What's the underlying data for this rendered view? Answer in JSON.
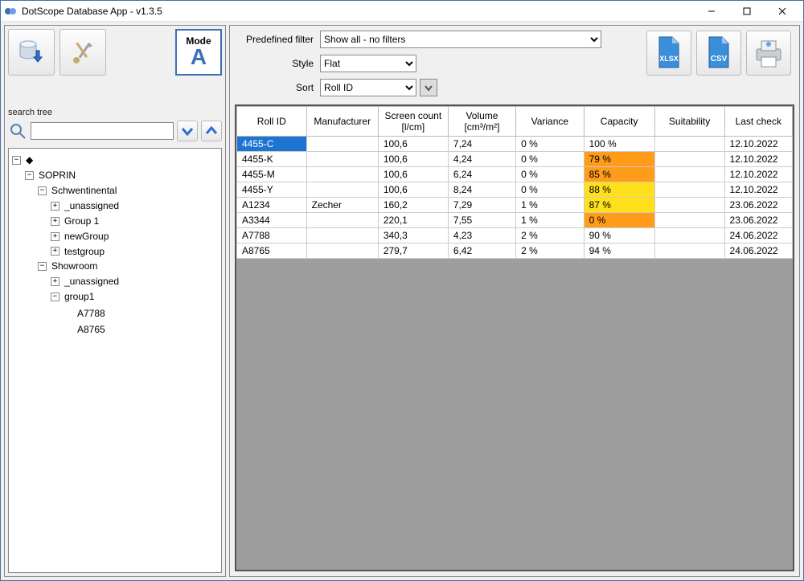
{
  "window": {
    "title": "DotScope Database App - v1.3.5"
  },
  "mode": {
    "label": "Mode",
    "letter": "A"
  },
  "search": {
    "label": "search tree",
    "value": "",
    "placeholder": ""
  },
  "tree": {
    "root_label": "SOPRIN",
    "nodes": [
      {
        "label": "Schwentinental",
        "children": [
          {
            "label": "_unassigned"
          },
          {
            "label": "Group 1"
          },
          {
            "label": "newGroup"
          },
          {
            "label": "testgroup"
          }
        ]
      },
      {
        "label": "Showroom",
        "children": [
          {
            "label": "_unassigned"
          },
          {
            "label": "group1",
            "children": [
              {
                "label": "A7788"
              },
              {
                "label": "A8765"
              }
            ]
          }
        ]
      }
    ]
  },
  "filters": {
    "predef_label": "Predefined filter",
    "predef_value": "Show all - no filters",
    "style_label": "Style",
    "style_value": "Flat",
    "sort_label": "Sort",
    "sort_value": "Roll ID"
  },
  "export": {
    "xlsx": "XLSX",
    "csv": "CSV"
  },
  "table": {
    "headers": {
      "roll_id": "Roll ID",
      "manufacturer": "Manufacturer",
      "screen_count": "Screen count\n[l/cm]",
      "volume": "Volume\n[cm³/m²]",
      "variance": "Variance",
      "capacity": "Capacity",
      "suitability": "Suitability",
      "last_check": "Last check"
    },
    "rows": [
      {
        "roll_id": "4455-C",
        "manufacturer": "",
        "screen_count": "100,6",
        "volume": "7,24",
        "variance": "0 %",
        "capacity": "100 %",
        "capacity_status": "",
        "suitability": "",
        "last_check": "12.10.2022",
        "selected": true
      },
      {
        "roll_id": "4455-K",
        "manufacturer": "",
        "screen_count": "100,6",
        "volume": "4,24",
        "variance": "0 %",
        "capacity": "79 %",
        "capacity_status": "orange",
        "suitability": "",
        "last_check": "12.10.2022"
      },
      {
        "roll_id": "4455-M",
        "manufacturer": "",
        "screen_count": "100,6",
        "volume": "6,24",
        "variance": "0 %",
        "capacity": "85 %",
        "capacity_status": "orange",
        "suitability": "",
        "last_check": "12.10.2022"
      },
      {
        "roll_id": "4455-Y",
        "manufacturer": "",
        "screen_count": "100,6",
        "volume": "8,24",
        "variance": "0 %",
        "capacity": "88 %",
        "capacity_status": "yellow",
        "suitability": "",
        "last_check": "12.10.2022"
      },
      {
        "roll_id": "A1234",
        "manufacturer": "Zecher",
        "screen_count": "160,2",
        "volume": "7,29",
        "variance": "1 %",
        "capacity": "87 %",
        "capacity_status": "yellow",
        "suitability": "",
        "last_check": "23.06.2022"
      },
      {
        "roll_id": "A3344",
        "manufacturer": "",
        "screen_count": "220,1",
        "volume": "7,55",
        "variance": "1 %",
        "capacity": "0 %",
        "capacity_status": "orange",
        "suitability": "",
        "last_check": "23.06.2022"
      },
      {
        "roll_id": "A7788",
        "manufacturer": "",
        "screen_count": "340,3",
        "volume": "4,23",
        "variance": "2 %",
        "capacity": "90 %",
        "capacity_status": "",
        "suitability": "",
        "last_check": "24.06.2022"
      },
      {
        "roll_id": "A8765",
        "manufacturer": "",
        "screen_count": "279,7",
        "volume": "6,42",
        "variance": "2 %",
        "capacity": "94 %",
        "capacity_status": "",
        "suitability": "",
        "last_check": "24.06.2022"
      }
    ]
  }
}
